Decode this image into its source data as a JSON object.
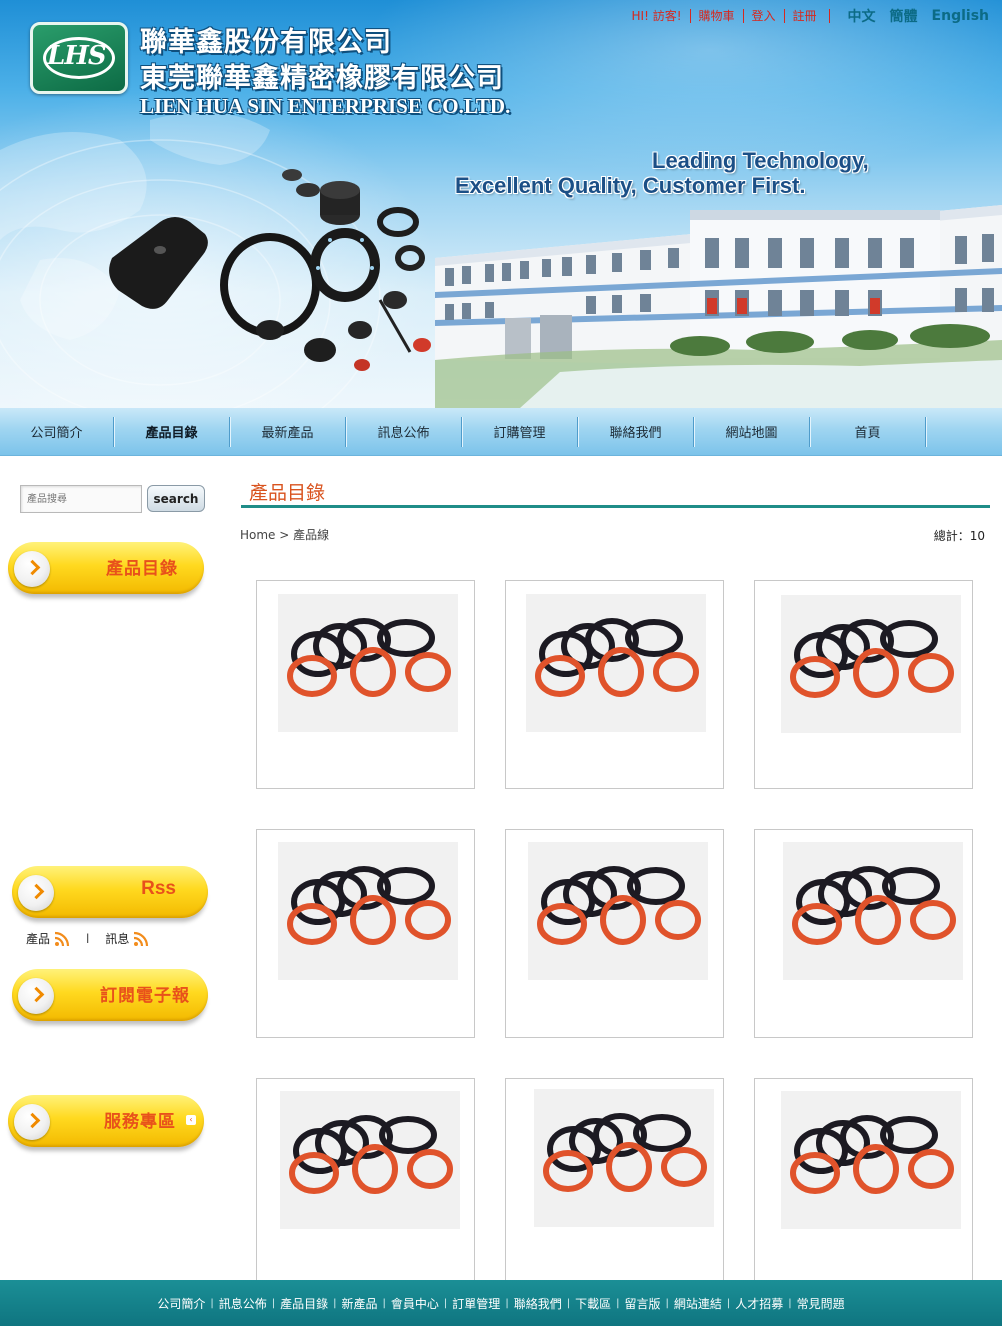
{
  "header": {
    "company_name_zh1": "聯華鑫股份有限公司",
    "company_name_zh2": "東莞聯華鑫精密橡膠有限公司",
    "company_name_en": "LIEN HUA SIN ENTERPRISE CO.LTD.",
    "slogan_line1": "Leading Technology,",
    "slogan_line2": "Excellent Quality, Customer First.",
    "logo_text": "LHS",
    "top_links": [
      "HI! 訪客!",
      "購物車",
      "登入",
      "註冊"
    ],
    "languages": [
      "中文",
      "簡體",
      "English"
    ]
  },
  "nav": {
    "items": [
      "公司簡介",
      "產品目錄",
      "最新產品",
      "訊息公佈",
      "訂購管理",
      "聯絡我們",
      "網站地圖",
      "首頁"
    ],
    "active_index": 1
  },
  "sidebar": {
    "search_placeholder": "產品搜尋",
    "search_button": "search",
    "catalog_label": "產品目錄",
    "rss_label": "Rss",
    "rss_links": [
      "產品",
      "訊息"
    ],
    "rss_separator": "l",
    "newsletter_label": "訂閱電子報",
    "service_label": "服務專區"
  },
  "main": {
    "section_title": "產品目錄",
    "breadcrumb": "Home > 產品線",
    "total": "總計：10",
    "products_visible": 9,
    "product_image": "o-ring-set-black-orange"
  },
  "footer": {
    "links": [
      "公司簡介",
      "訊息公佈",
      "產品目錄",
      "新產品",
      "會員中心",
      "訂單管理",
      "聯絡我們",
      "下載區",
      "留言版",
      "網站連結",
      "人才招募",
      "常見問題"
    ]
  },
  "colors": {
    "accent_orange": "#d9531e",
    "teal_rule": "#1f8d88",
    "footer_bg": "#1b8f96",
    "link_red": "#d6281f",
    "button_yellow": "#ffd91f"
  }
}
